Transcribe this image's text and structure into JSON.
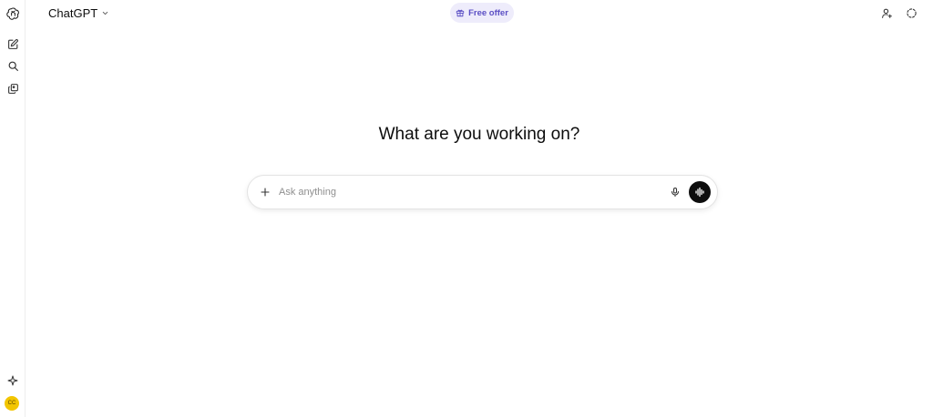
{
  "header": {
    "model_label": "ChatGPT",
    "free_offer_label": "Free offer"
  },
  "main": {
    "headline": "What are you working on?",
    "composer": {
      "placeholder": "Ask anything",
      "value": ""
    }
  },
  "sidebar": {
    "avatar_initials": "CC",
    "icons": [
      "openai-logo-icon",
      "new-chat-icon",
      "search-icon",
      "library-icon",
      "sparkle-icon"
    ]
  },
  "colors": {
    "free_offer_bg": "#eeecfb",
    "free_offer_text": "#5b4fc4",
    "avatar": "#f2c500",
    "voice_button": "#0d0d0d"
  }
}
